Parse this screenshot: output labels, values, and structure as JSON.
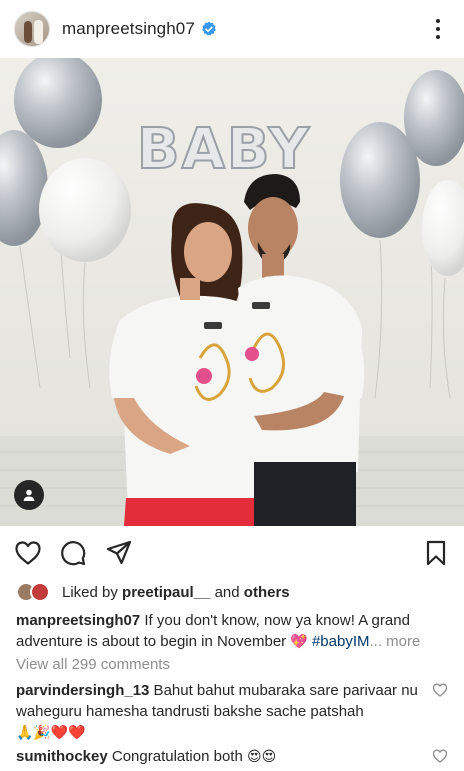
{
  "post": {
    "username": "manpreetsingh07",
    "verified": true,
    "photo_balloon_text": "BABY"
  },
  "icons": {
    "verified": "verified-badge-icon",
    "more": "more-options-icon",
    "user_tag": "user-tag-icon",
    "like": "heart-icon",
    "comment": "comment-icon",
    "share": "share-icon",
    "save": "bookmark-icon"
  },
  "likes": {
    "prefix": "Liked by ",
    "user": "preetipaul__",
    "middle": " and ",
    "others": "others"
  },
  "caption": {
    "user": "manpreetsingh07",
    "text": " If you don't know, now ya know! A grand adventure is about to begin in November ",
    "emoji": "💖",
    "hashtag": " #babyIM",
    "more": "... more"
  },
  "comments_link": "View all 299 comments",
  "comments": [
    {
      "user": "parvindersingh_13",
      "text": " Bahut bahut mubaraka sare parivaar nu waheguru hamesha tandrusti bakshe sache patshah",
      "emoji": "🙏🎉❤️❤️"
    },
    {
      "user": "sumithockey",
      "text": " Congratulation both ",
      "emoji": "😍😍"
    }
  ],
  "colors": {
    "text": "#262626",
    "secondary": "#8e8e8e",
    "verified_blue": "#3897f0",
    "hashtag": "#00376b",
    "balloon_silver": "#b9bec4"
  }
}
